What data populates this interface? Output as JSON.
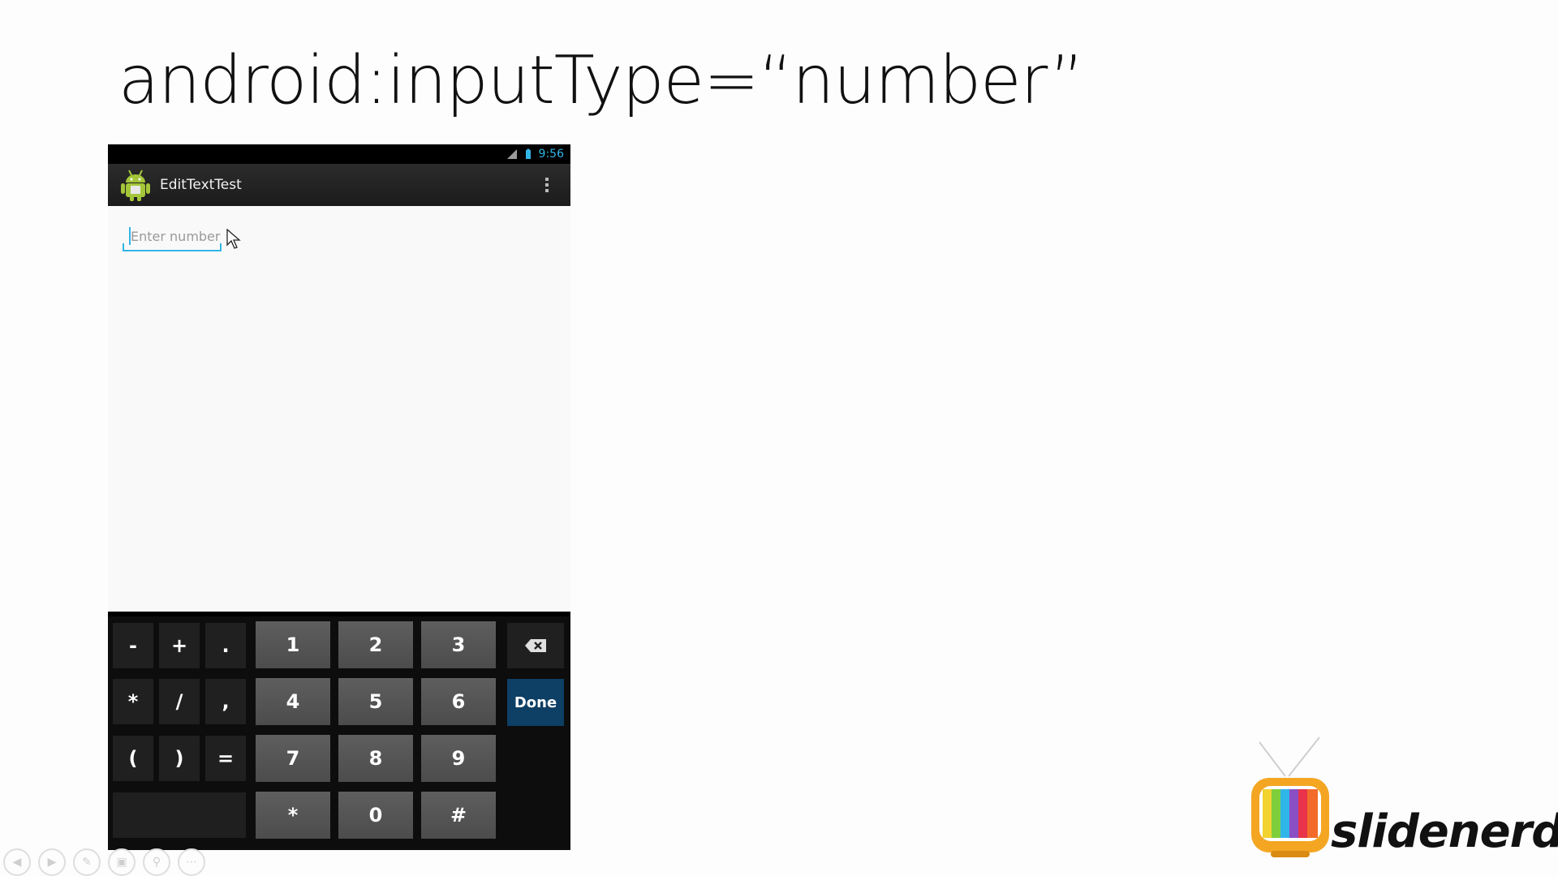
{
  "slide": {
    "title": "android:inputType=“number”"
  },
  "phone": {
    "status_bar": {
      "time": "9:56",
      "icons": [
        "signal-icon",
        "battery-icon"
      ]
    },
    "action_bar": {
      "app_title": "EditTextTest",
      "app_icon": "android-icon",
      "menu_icon": "overflow-menu-icon"
    },
    "edit_text": {
      "placeholder": "Enter number",
      "value": ""
    },
    "keyboard": {
      "keys": {
        "minus": "-",
        "plus": "+",
        "period": ".",
        "one": "1",
        "two": "2",
        "three": "3",
        "asterisk_sym": "*",
        "slash": "/",
        "comma": ",",
        "four": "4",
        "five": "5",
        "six": "6",
        "open_paren": "(",
        "close_paren": ")",
        "equals": "=",
        "seven": "7",
        "eight": "8",
        "nine": "9",
        "asterisk": "*",
        "zero": "0",
        "hash": "#",
        "done": "Done"
      },
      "backspace_icon": "backspace-icon"
    }
  },
  "controls": [
    "previous-icon",
    "next-icon",
    "pen-icon",
    "slides-icon",
    "zoom-icon",
    "more-icon"
  ],
  "logo": {
    "text": "slidenerd",
    "icon": "tv-icon"
  },
  "colors": {
    "accent": "#33b5e5",
    "done_key": "#0e3f64",
    "number_key": "#555555",
    "symbol_key": "#202020"
  }
}
